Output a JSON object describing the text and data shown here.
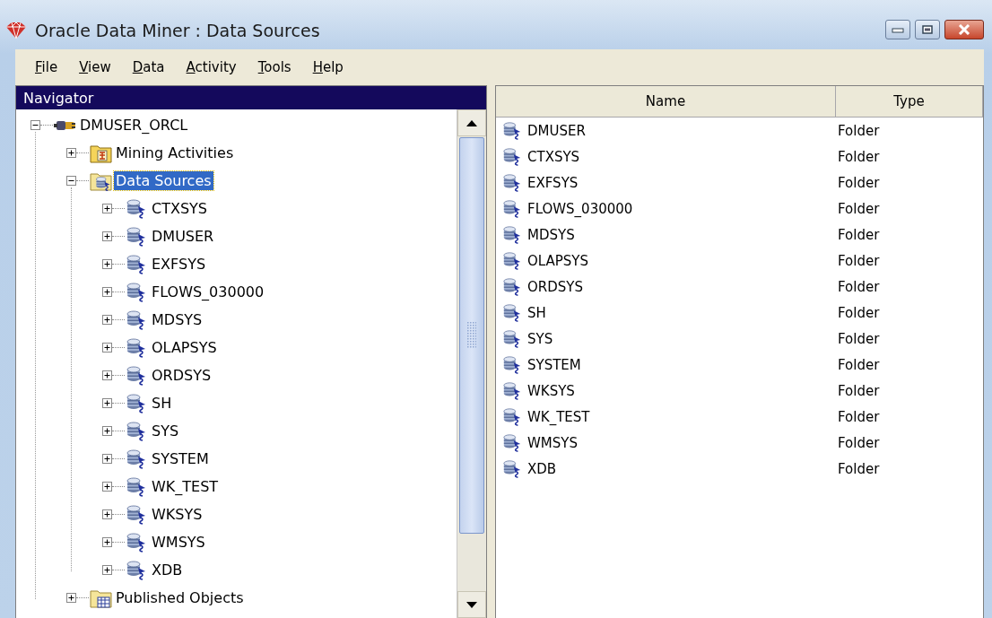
{
  "window": {
    "title": "Oracle Data Miner : Data Sources"
  },
  "menu": [
    "File",
    "View",
    "Data",
    "Activity",
    "Tools",
    "Help"
  ],
  "navigator": {
    "title": "Navigator",
    "tree": [
      {
        "label": "DMUSER_ORCL",
        "kind": "connection",
        "expanded": true,
        "selected": false,
        "children": [
          {
            "label": "Mining Activities",
            "kind": "activities",
            "expanded": false,
            "selected": false
          },
          {
            "label": "Data Sources",
            "kind": "sources",
            "expanded": true,
            "selected": true,
            "children": [
              {
                "label": "CTXSYS",
                "kind": "schema",
                "expanded": false,
                "selected": false
              },
              {
                "label": "DMUSER",
                "kind": "schema",
                "expanded": false,
                "selected": false
              },
              {
                "label": "EXFSYS",
                "kind": "schema",
                "expanded": false,
                "selected": false
              },
              {
                "label": "FLOWS_030000",
                "kind": "schema",
                "expanded": false,
                "selected": false
              },
              {
                "label": "MDSYS",
                "kind": "schema",
                "expanded": false,
                "selected": false
              },
              {
                "label": "OLAPSYS",
                "kind": "schema",
                "expanded": false,
                "selected": false
              },
              {
                "label": "ORDSYS",
                "kind": "schema",
                "expanded": false,
                "selected": false
              },
              {
                "label": "SH",
                "kind": "schema",
                "expanded": false,
                "selected": false
              },
              {
                "label": "SYS",
                "kind": "schema",
                "expanded": false,
                "selected": false
              },
              {
                "label": "SYSTEM",
                "kind": "schema",
                "expanded": false,
                "selected": false
              },
              {
                "label": "WK_TEST",
                "kind": "schema",
                "expanded": false,
                "selected": false
              },
              {
                "label": "WKSYS",
                "kind": "schema",
                "expanded": false,
                "selected": false
              },
              {
                "label": "WMSYS",
                "kind": "schema",
                "expanded": false,
                "selected": false
              },
              {
                "label": "XDB",
                "kind": "schema",
                "expanded": false,
                "selected": false
              }
            ]
          },
          {
            "label": "Published Objects",
            "kind": "published",
            "expanded": false,
            "selected": false
          }
        ]
      }
    ]
  },
  "table": {
    "columns": [
      "Name",
      "Type"
    ],
    "rows": [
      {
        "name": "DMUSER",
        "type": "Folder"
      },
      {
        "name": "CTXSYS",
        "type": "Folder"
      },
      {
        "name": "EXFSYS",
        "type": "Folder"
      },
      {
        "name": "FLOWS_030000",
        "type": "Folder"
      },
      {
        "name": "MDSYS",
        "type": "Folder"
      },
      {
        "name": "OLAPSYS",
        "type": "Folder"
      },
      {
        "name": "ORDSYS",
        "type": "Folder"
      },
      {
        "name": "SH",
        "type": "Folder"
      },
      {
        "name": "SYS",
        "type": "Folder"
      },
      {
        "name": "SYSTEM",
        "type": "Folder"
      },
      {
        "name": "WKSYS",
        "type": "Folder"
      },
      {
        "name": "WK_TEST",
        "type": "Folder"
      },
      {
        "name": "WMSYS",
        "type": "Folder"
      },
      {
        "name": "XDB",
        "type": "Folder"
      }
    ]
  }
}
